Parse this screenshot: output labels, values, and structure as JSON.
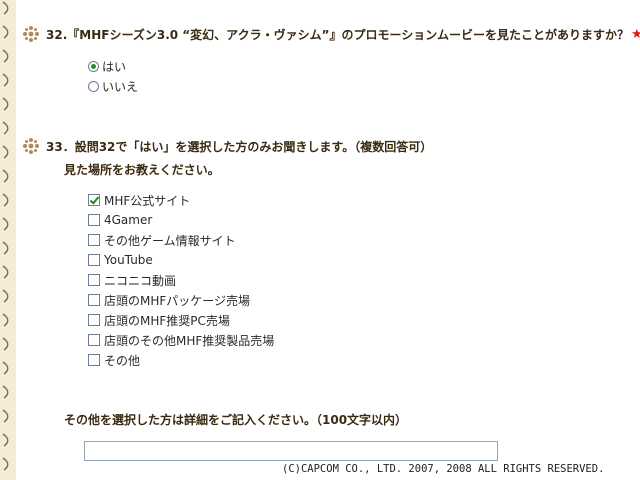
{
  "q32": {
    "heading": "32.『MHFシーズン3.0 “変幻、アクラ・ヴァシム”』のプロモーションムービーを見たことがありますか？",
    "required_mark": "★",
    "options": [
      {
        "label": "はい",
        "selected": true
      },
      {
        "label": "いいえ",
        "selected": false
      }
    ]
  },
  "q33": {
    "heading": "33．設問32で「はい」を選択した方のみお聞きします。（複数回答可）",
    "subheading": "見た場所をお教えください。",
    "options": [
      {
        "label": "MHF公式サイト",
        "checked": true
      },
      {
        "label": "4Gamer",
        "checked": false
      },
      {
        "label": "その他ゲーム情報サイト",
        "checked": false
      },
      {
        "label": "YouTube",
        "checked": false
      },
      {
        "label": "ニコニコ動画",
        "checked": false
      },
      {
        "label": "店頭のMHFパッケージ売場",
        "checked": false
      },
      {
        "label": "店頭のMHF推奨PC売場",
        "checked": false
      },
      {
        "label": "店頭のその他MHF推奨製品売場",
        "checked": false
      },
      {
        "label": "その他",
        "checked": false
      }
    ],
    "other_prompt": "その他を選択した方は詳細をご記入ください。（100文字以内）",
    "other_value": ""
  },
  "footer": {
    "copyright": "(C)CAPCOM CO., LTD. 2007, 2008 ALL RIGHTS RESERVED."
  },
  "colors": {
    "heading_text": "#3a2a12",
    "required_star": "#e01a1a",
    "check_mark": "#1f8a1f",
    "binding_strip": "#f4ecd8"
  },
  "icons": {
    "question_marker": "ornament-icon",
    "binding": "binding-ring-icon"
  }
}
